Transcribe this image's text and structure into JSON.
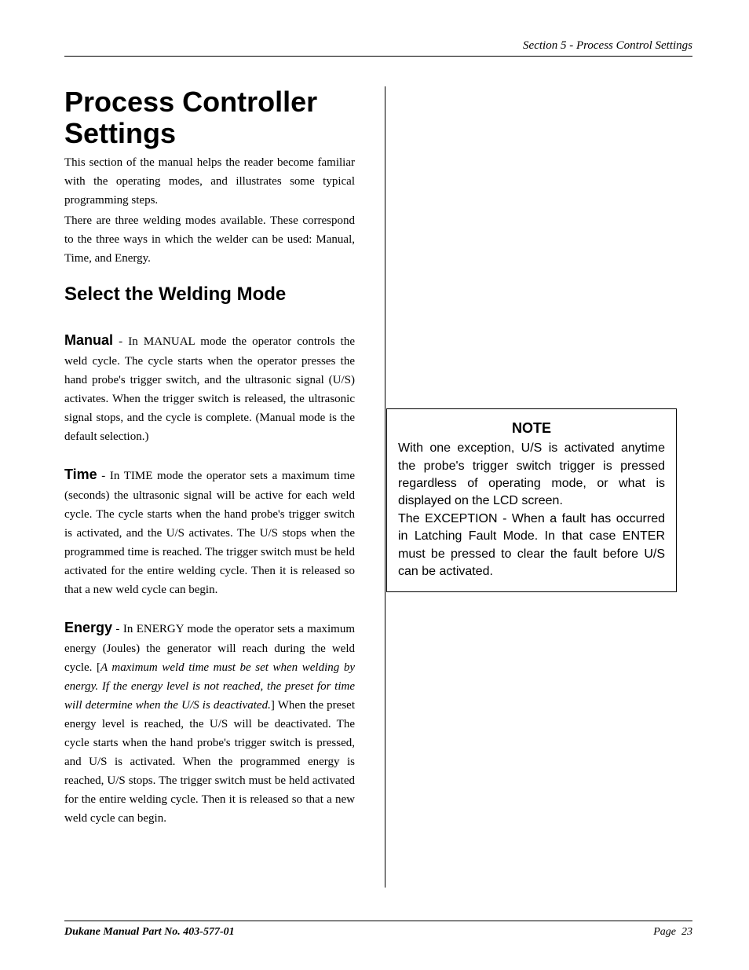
{
  "header": {
    "section_label": "Section 5 - Process Control Settings"
  },
  "title": "Process Controller Settings",
  "intro_p1": "This section of the manual helps the reader become familiar with the operating modes, and illustrates some typical programming steps.",
  "intro_p2": "There are three welding modes available. These correspond to the three ways in which the welder can be used: Manual, Time, and Energy.",
  "subheading": "Select the Welding Mode",
  "modes": {
    "manual": {
      "label": "Manual",
      "text": " - In MANUAL mode the operator controls the weld cycle. The cycle starts when the operator presses the hand probe's trigger switch, and the ultrasonic signal (U/S) activates. When the trigger switch is released, the ultrasonic signal stops, and the cycle is complete. (Manual mode is the default selection.)"
    },
    "time": {
      "label": "Time",
      "text": " - In TIME mode the operator sets a maximum time (seconds) the ultrasonic signal will be active for each weld cycle. The cycle starts when the hand probe's trigger switch is activated, and the U/S activates. The U/S stops when the programmed time is reached. The trigger switch must be held activated for the entire welding cycle. Then it is released so that a new weld cycle can begin."
    },
    "energy": {
      "label": "Energy",
      "pre": " - In ENERGY mode the operator sets a maximum energy (Joules) the generator will reach during the weld cycle. [",
      "ital": "A maximum weld time must be set when welding by energy. If the energy level is not reached, the preset for time will determine when the U/S is deactivated.",
      "post": "] When the preset energy level is reached, the U/S will be deactivated. The cycle starts when the hand probe's trigger switch is pressed, and U/S is activated. When the programmed energy is reached, U/S stops. The trigger switch must be held activated for the entire welding cycle. Then it is released so that a new weld cycle can begin."
    }
  },
  "note": {
    "title": "NOTE",
    "p1": "With one exception, U/S is activated anytime the probe's trigger switch trigger is pressed regardless of operating mode, or what is displayed on the LCD screen.",
    "p2": "The EXCEPTION - When a fault has occurred in Latching Fault Mode. In that case ENTER must be pressed to clear the fault before U/S can be activated."
  },
  "footer": {
    "left": "Dukane Manual Part No. 403-577-01",
    "right_label": "Page",
    "page_num": "23"
  }
}
